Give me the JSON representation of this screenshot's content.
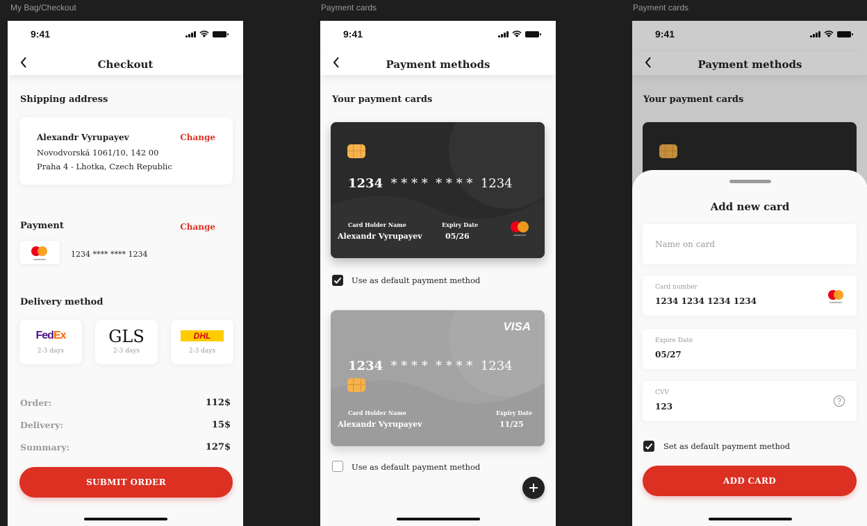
{
  "frames": [
    {
      "label": "My Bag/Checkout"
    },
    {
      "label": "Payment cards"
    },
    {
      "label": "Payment cards"
    }
  ],
  "status": {
    "time": "9:41"
  },
  "checkout": {
    "title": "Checkout",
    "shipping_title": "Shipping address",
    "address": {
      "name": "Alexandr Vyrupayev",
      "change": "Change",
      "line1": "Novodvorská 1061/10, 142 00",
      "line2": "Praha 4 - Lhotka, Czech Republic"
    },
    "payment_title": "Payment",
    "payment_change": "Change",
    "payment_card": "1234 **** **** 1234",
    "mastercard_label": "mastercard",
    "delivery_title": "Delivery method",
    "delivery_options": [
      {
        "name": "FedEx",
        "days": "2-3 days"
      },
      {
        "name": "GLS",
        "days": "2-3 days"
      },
      {
        "name": "DHL",
        "days": "2-3 days"
      }
    ],
    "summary": [
      {
        "label": "Order:",
        "value": "112$"
      },
      {
        "label": "Delivery:",
        "value": "15$"
      },
      {
        "label": "Summary:",
        "value": "127$"
      }
    ],
    "submit": "SUBMIT ORDER"
  },
  "payment": {
    "title": "Payment methods",
    "section": "Your payment cards",
    "cards": [
      {
        "number_start": "1234",
        "number_mask": "* * * *  * * * *",
        "number_end": "1234",
        "holder_label": "Card Holder Name",
        "holder": "Alexandr Vyrupayev",
        "expiry_label": "Expiry Date",
        "expiry": "05/26",
        "brand": "mastercard",
        "default_text": "Use as default payment method",
        "default": true
      },
      {
        "number_start": "1234",
        "number_mask": "* * * *  * * * *",
        "number_end": "1234",
        "holder_label": "Card Holder Name",
        "holder": "Alexandr Vyrupayev",
        "expiry_label": "Expiry Date",
        "expiry": "11/25",
        "brand": "VISA",
        "default_text": "Use as default payment method",
        "default": false
      }
    ],
    "add_icon": "plus-icon"
  },
  "add_card": {
    "title": "Payment methods",
    "section": "Your payment cards",
    "sheet_title": "Add new card",
    "name_placeholder": "Name on card",
    "card_number_label": "Card number",
    "card_number": "1234 1234 1234 1234",
    "expire_label": "Expire Date",
    "expire": "05/27",
    "cvv_label": "CVV",
    "cvv": "123",
    "default_text": "Set as default payment method",
    "default": true,
    "button": "ADD CARD"
  },
  "colors": {
    "accent": "#db3022",
    "card_dark": "#2a2a2a",
    "card_grey": "#a3a3a3",
    "chip": "#f5b24d"
  }
}
